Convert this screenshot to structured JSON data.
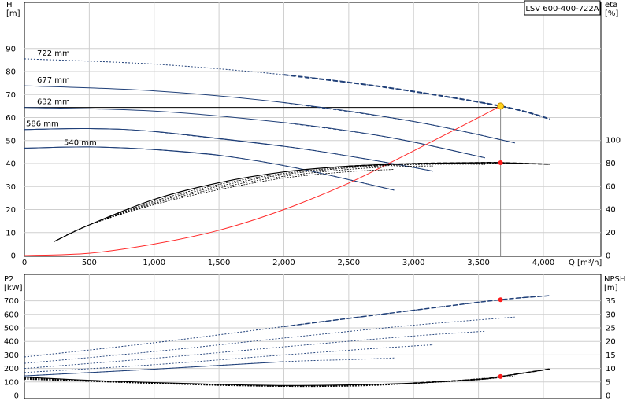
{
  "chart_data": [
    {
      "type": "line",
      "title": "LSV 600-400-722A",
      "xlabel": "Q [m³/h]",
      "ylabel_left": "H\n[m]",
      "ylabel_right": "eta\n[%]",
      "xlim": [
        0,
        4200
      ],
      "ylim_left": [
        0,
        100
      ],
      "ylim_right": [
        0,
        150
      ],
      "x_ticks": [
        0,
        500,
        1000,
        1500,
        2000,
        2500,
        3000,
        3500,
        4000
      ],
      "x_tick_labels": [
        "0",
        "500",
        "1,000",
        "1,500",
        "2,000",
        "2,500",
        "3,000",
        "3,500",
        "4,000"
      ],
      "y_ticks_left": [
        0,
        10,
        20,
        30,
        40,
        50,
        60,
        70,
        80,
        90
      ],
      "y_ticks_right": [
        0,
        20,
        40,
        60,
        80,
        100
      ],
      "grid": true,
      "head_curves": [
        {
          "name": "722 mm",
          "x": [
            0,
            1000,
            2000,
            2800,
            3670,
            4050
          ],
          "y": [
            85.5,
            83.2,
            78.6,
            73.0,
            65.0,
            59.4
          ]
        },
        {
          "name": "677 mm",
          "x": [
            0,
            1000,
            2000,
            3000,
            3780
          ],
          "y": [
            73.8,
            71.6,
            66.5,
            58.3,
            49.0
          ]
        },
        {
          "name": "632 mm",
          "x": [
            0,
            1000,
            2000,
            2800,
            3550
          ],
          "y": [
            64.4,
            62.8,
            57.8,
            51.5,
            42.5
          ]
        },
        {
          "name": "586 mm",
          "x": [
            0,
            500,
            1000,
            2000,
            2600,
            3150
          ],
          "y": [
            54.8,
            55.2,
            53.9,
            47.5,
            42.3,
            36.7
          ]
        },
        {
          "name": "540 mm",
          "x": [
            0,
            500,
            1000,
            1500,
            2100,
            2850
          ],
          "y": [
            46.7,
            47.2,
            46.1,
            43.6,
            38.0,
            28.4
          ]
        }
      ],
      "system_curve": {
        "x": [
          0,
          500,
          1000,
          1500,
          2000,
          2500,
          3000,
          3670
        ],
        "y": [
          0,
          1.0,
          5.0,
          11.0,
          20.0,
          31.5,
          45.5,
          65.0
        ]
      },
      "duty_head": 64.4,
      "duty_flow": 3670,
      "efficiency_curves": [
        {
          "x": [
            230,
            500,
            1000,
            1500,
            2000,
            2500,
            3000,
            3500,
            3670,
            4050
          ],
          "y": [
            12.2,
            26.5,
            48.5,
            63.0,
            72.3,
            77.3,
            79.5,
            80.3,
            80.3,
            79.0
          ]
        },
        {
          "x": [
            230,
            500,
            1000,
            1500,
            2000,
            2500,
            3000,
            3500,
            3780
          ],
          "y": [
            12.2,
            26.5,
            47.0,
            61.5,
            71.0,
            76.5,
            79.2,
            79.8,
            79.5
          ]
        },
        {
          "x": [
            230,
            500,
            1000,
            1500,
            2000,
            2500,
            3000,
            3400,
            3550
          ],
          "y": [
            12.2,
            26.5,
            46.0,
            60.0,
            70.0,
            75.8,
            78.6,
            79.0,
            78.7
          ]
        },
        {
          "x": [
            230,
            500,
            1000,
            1500,
            2000,
            2500,
            2900,
            3150
          ],
          "y": [
            12.2,
            26.5,
            45.0,
            58.5,
            68.5,
            74.5,
            77.0,
            77.5
          ]
        },
        {
          "x": [
            230,
            500,
            1000,
            1500,
            2000,
            2500,
            2850
          ],
          "y": [
            12.2,
            26.5,
            44.0,
            57.0,
            67.0,
            72.5,
            74.5
          ]
        }
      ],
      "duty_efficiency": 80.3
    },
    {
      "type": "line",
      "xlabel": "",
      "ylabel_left": "P2\n[kW]",
      "ylabel_right": "NPSH\n[m]",
      "xlim": [
        0,
        4200
      ],
      "ylim_left": [
        0,
        800
      ],
      "ylim_right": [
        0,
        40
      ],
      "x_ticks": [
        0,
        500,
        1000,
        1500,
        2000,
        2500,
        3000,
        3500,
        4000
      ],
      "y_ticks_left": [
        0,
        100,
        200,
        300,
        400,
        500,
        600,
        700
      ],
      "y_ticks_right": [
        0,
        5,
        10,
        15,
        20,
        25,
        30,
        35
      ],
      "grid": true,
      "power_curves": [
        {
          "x": [
            0,
            1000,
            2000,
            3000,
            3670,
            4050
          ],
          "y": [
            285,
            390,
            510,
            630,
            708,
            738
          ]
        },
        {
          "x": [
            0,
            1000,
            2000,
            3000,
            3780
          ],
          "y": [
            238,
            325,
            425,
            520,
            580
          ]
        },
        {
          "x": [
            0,
            1000,
            2000,
            3000,
            3550
          ],
          "y": [
            200,
            275,
            360,
            440,
            475
          ]
        },
        {
          "x": [
            0,
            1000,
            2000,
            2700,
            3150
          ],
          "y": [
            170,
            228,
            300,
            348,
            375
          ]
        },
        {
          "x": [
            0,
            1000,
            2000,
            2500,
            2850
          ],
          "y": [
            145,
            195,
            250,
            265,
            278
          ]
        }
      ],
      "duty_power": 708,
      "npsh_curves": [
        {
          "x": [
            0,
            500,
            1000,
            1500,
            2000,
            2500,
            3000,
            3500,
            3670,
            4050
          ],
          "y": [
            6.8,
            5.6,
            4.8,
            4.1,
            3.7,
            3.9,
            4.6,
            6.0,
            7.0,
            9.8
          ]
        },
        {
          "x": [
            0,
            500,
            1000,
            1500,
            2000,
            2500,
            3000,
            3500,
            3780
          ],
          "y": [
            6.6,
            5.5,
            4.7,
            4.0,
            3.6,
            3.8,
            4.5,
            5.8,
            7.3
          ]
        },
        {
          "x": [
            0,
            500,
            1000,
            1500,
            2000,
            2500,
            3000,
            3550
          ],
          "y": [
            6.4,
            5.4,
            4.6,
            3.9,
            3.5,
            3.7,
            4.4,
            6.4
          ]
        },
        {
          "x": [
            0,
            500,
            1000,
            1500,
            2000,
            2500,
            3150
          ],
          "y": [
            6.2,
            5.3,
            4.5,
            3.8,
            3.4,
            3.6,
            4.9
          ]
        },
        {
          "x": [
            0,
            500,
            1000,
            1500,
            2000,
            2500,
            2850
          ],
          "y": [
            6.0,
            5.2,
            4.4,
            3.7,
            3.3,
            3.4,
            4.0
          ]
        }
      ],
      "duty_npsh": 7.0
    }
  ]
}
